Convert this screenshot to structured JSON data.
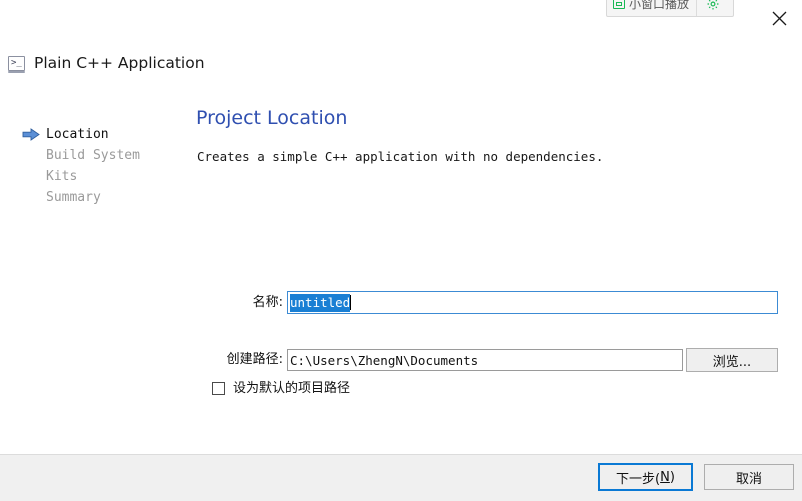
{
  "overlay": {
    "label": "小窗口播放",
    "window_icon": "small-window-icon",
    "gear_icon": "gear-icon",
    "accent_color": "#19b955"
  },
  "window": {
    "close_label": "✕",
    "title": "Plain C++ Application",
    "title_icon": "console-icon",
    "prompt_glyph": ">_"
  },
  "steps": [
    {
      "label": "Location",
      "active": true
    },
    {
      "label": "Build System",
      "active": false
    },
    {
      "label": "Kits",
      "active": false
    },
    {
      "label": "Summary",
      "active": false
    }
  ],
  "pane": {
    "title": "Project Location",
    "title_color": "#2f4fb0",
    "description": "Creates a simple C++ application with no dependencies."
  },
  "form": {
    "name_label": "名称:",
    "name_value": "untitled",
    "name_selected": true,
    "selection_color": "#1a7fd4",
    "path_label": "创建路径:",
    "path_value": "C:\\Users\\ZhengN\\Documents",
    "browse_label": "浏览...",
    "default_path_label": "设为默认的项目路径",
    "default_path_checked": false
  },
  "footer": {
    "next_label": "下一步(",
    "next_accel": "N",
    "next_label_end": ")",
    "cancel_label": "取消",
    "default_button_color": "#0a79d4"
  }
}
